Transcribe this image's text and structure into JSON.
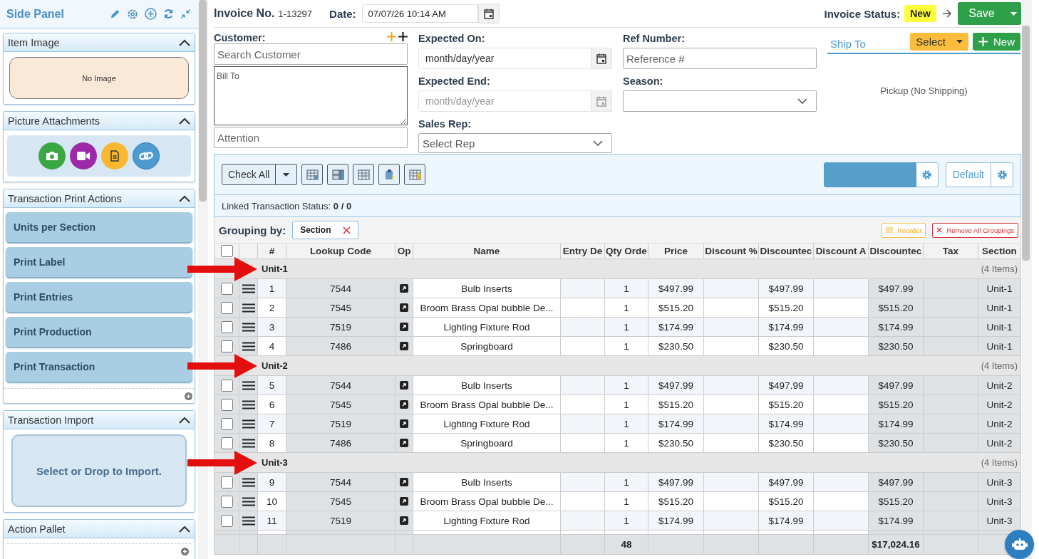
{
  "side_panel": {
    "title": "Side Panel",
    "sections": [
      {
        "kind": "image",
        "title": "Item Image",
        "expanded": true,
        "text": "No Image"
      },
      {
        "kind": "attachments",
        "title": "Picture Attachments",
        "expanded": true
      },
      {
        "kind": "actions",
        "title": "Transaction Print Actions",
        "expanded": true,
        "buttons": [
          "Units per Section",
          "Print Label",
          "Print Entries",
          "Print Production",
          "Print Transaction"
        ]
      },
      {
        "kind": "import",
        "title": "Transaction Import",
        "expanded": true,
        "text": "Select or Drop to Import."
      },
      {
        "kind": "pallet",
        "title": "Action Pallet",
        "expanded": true
      }
    ]
  },
  "invoice": {
    "label": "Invoice No.",
    "number": "1-13297",
    "date_label": "Date:",
    "date": "07/07/26 10:14 AM",
    "status_label": "Invoice Status:",
    "status": "New",
    "save": "Save"
  },
  "customer": {
    "label": "Customer:",
    "search": {
      "placeholder": "Search Customer"
    },
    "bill_to": {
      "placeholder": "Bill To"
    },
    "attention": {
      "placeholder": "Attention"
    }
  },
  "expected_on": {
    "label": "Expected On:",
    "placeholder": "month/day/year",
    "disabled": false
  },
  "expected_end": {
    "label": "Expected End:",
    "placeholder": "month/day/year",
    "disabled": true
  },
  "sales_rep": {
    "label": "Sales Rep:",
    "placeholder": "Select Rep"
  },
  "ref_number": {
    "label": "Ref Number:",
    "placeholder": "Reference #"
  },
  "season": {
    "label": "Season:"
  },
  "ship_to": {
    "tab": "Ship To",
    "select": "Select",
    "new": "New",
    "text": "Pickup (No Shipping)"
  },
  "toolbar": {
    "check_all": "Check All",
    "layout": "Default"
  },
  "linked_status": {
    "label": "Linked Transaction Status:",
    "value": "0 / 0"
  },
  "grouping": {
    "label": "Grouping by:",
    "chips": [
      "Section"
    ],
    "reorder": "Reorder",
    "remove_all": "Remove All Groupings"
  },
  "table": {
    "header_checked": false,
    "columns": [
      "#",
      "Lookup Code",
      "Op",
      "Name",
      "Entry De",
      "Qty Orde",
      "Price",
      "Discount %",
      "Discountec",
      "Discount A",
      "Discountec",
      "Tax",
      "Section"
    ],
    "groups": [
      {
        "label": "Unit-1",
        "count": "(4 Items)",
        "rows": [
          {
            "checked": false,
            "num": "1",
            "lookup": "7544",
            "name": "Bulb Inserts",
            "qty": "1",
            "price": "$497.99",
            "discounted": "$497.99",
            "discounted_total": "$497.99",
            "section": "Unit-1"
          },
          {
            "checked": false,
            "num": "2",
            "lookup": "7545",
            "name": "Broom Brass Opal bubble De...",
            "qty": "1",
            "price": "$515.20",
            "discounted": "$515.20",
            "discounted_total": "$515.20",
            "section": "Unit-1"
          },
          {
            "checked": false,
            "num": "3",
            "lookup": "7519",
            "name": "Lighting Fixture Rod",
            "qty": "1",
            "price": "$174.99",
            "discounted": "$174.99",
            "discounted_total": "$174.99",
            "section": "Unit-1"
          },
          {
            "checked": false,
            "num": "4",
            "lookup": "7486",
            "name": "Springboard",
            "qty": "1",
            "price": "$230.50",
            "discounted": "$230.50",
            "discounted_total": "$230.50",
            "section": "Unit-1"
          }
        ]
      },
      {
        "label": "Unit-2",
        "count": "(4 Items)",
        "rows": [
          {
            "checked": false,
            "num": "5",
            "lookup": "7544",
            "name": "Bulb Inserts",
            "qty": "1",
            "price": "$497.99",
            "discounted": "$497.99",
            "discounted_total": "$497.99",
            "section": "Unit-2"
          },
          {
            "checked": false,
            "num": "6",
            "lookup": "7545",
            "name": "Broom Brass Opal bubble De...",
            "qty": "1",
            "price": "$515.20",
            "discounted": "$515.20",
            "discounted_total": "$515.20",
            "section": "Unit-2"
          },
          {
            "checked": false,
            "num": "7",
            "lookup": "7519",
            "name": "Lighting Fixture Rod",
            "qty": "1",
            "price": "$174.99",
            "discounted": "$174.99",
            "discounted_total": "$174.99",
            "section": "Unit-2"
          },
          {
            "checked": false,
            "num": "8",
            "lookup": "7486",
            "name": "Springboard",
            "qty": "1",
            "price": "$230.50",
            "discounted": "$230.50",
            "discounted_total": "$230.50",
            "section": "Unit-2"
          }
        ]
      },
      {
        "label": "Unit-3",
        "count": "(4 Items)",
        "rows": [
          {
            "checked": false,
            "num": "9",
            "lookup": "7544",
            "name": "Bulb Inserts",
            "qty": "1",
            "price": "$497.99",
            "discounted": "$497.99",
            "discounted_total": "$497.99",
            "section": "Unit-3"
          },
          {
            "checked": false,
            "num": "10",
            "lookup": "7545",
            "name": "Broom Brass Opal bubble De...",
            "qty": "1",
            "price": "$515.20",
            "discounted": "$515.20",
            "discounted_total": "$515.20",
            "section": "Unit-3"
          },
          {
            "checked": false,
            "num": "11",
            "lookup": "7519",
            "name": "Lighting Fixture Rod",
            "qty": "1",
            "price": "$174.99",
            "discounted": "$174.99",
            "discounted_total": "$174.99",
            "section": "Unit-3"
          }
        ]
      }
    ],
    "totals": {
      "qty": "48",
      "discounted_total": "$17,024.16"
    }
  }
}
